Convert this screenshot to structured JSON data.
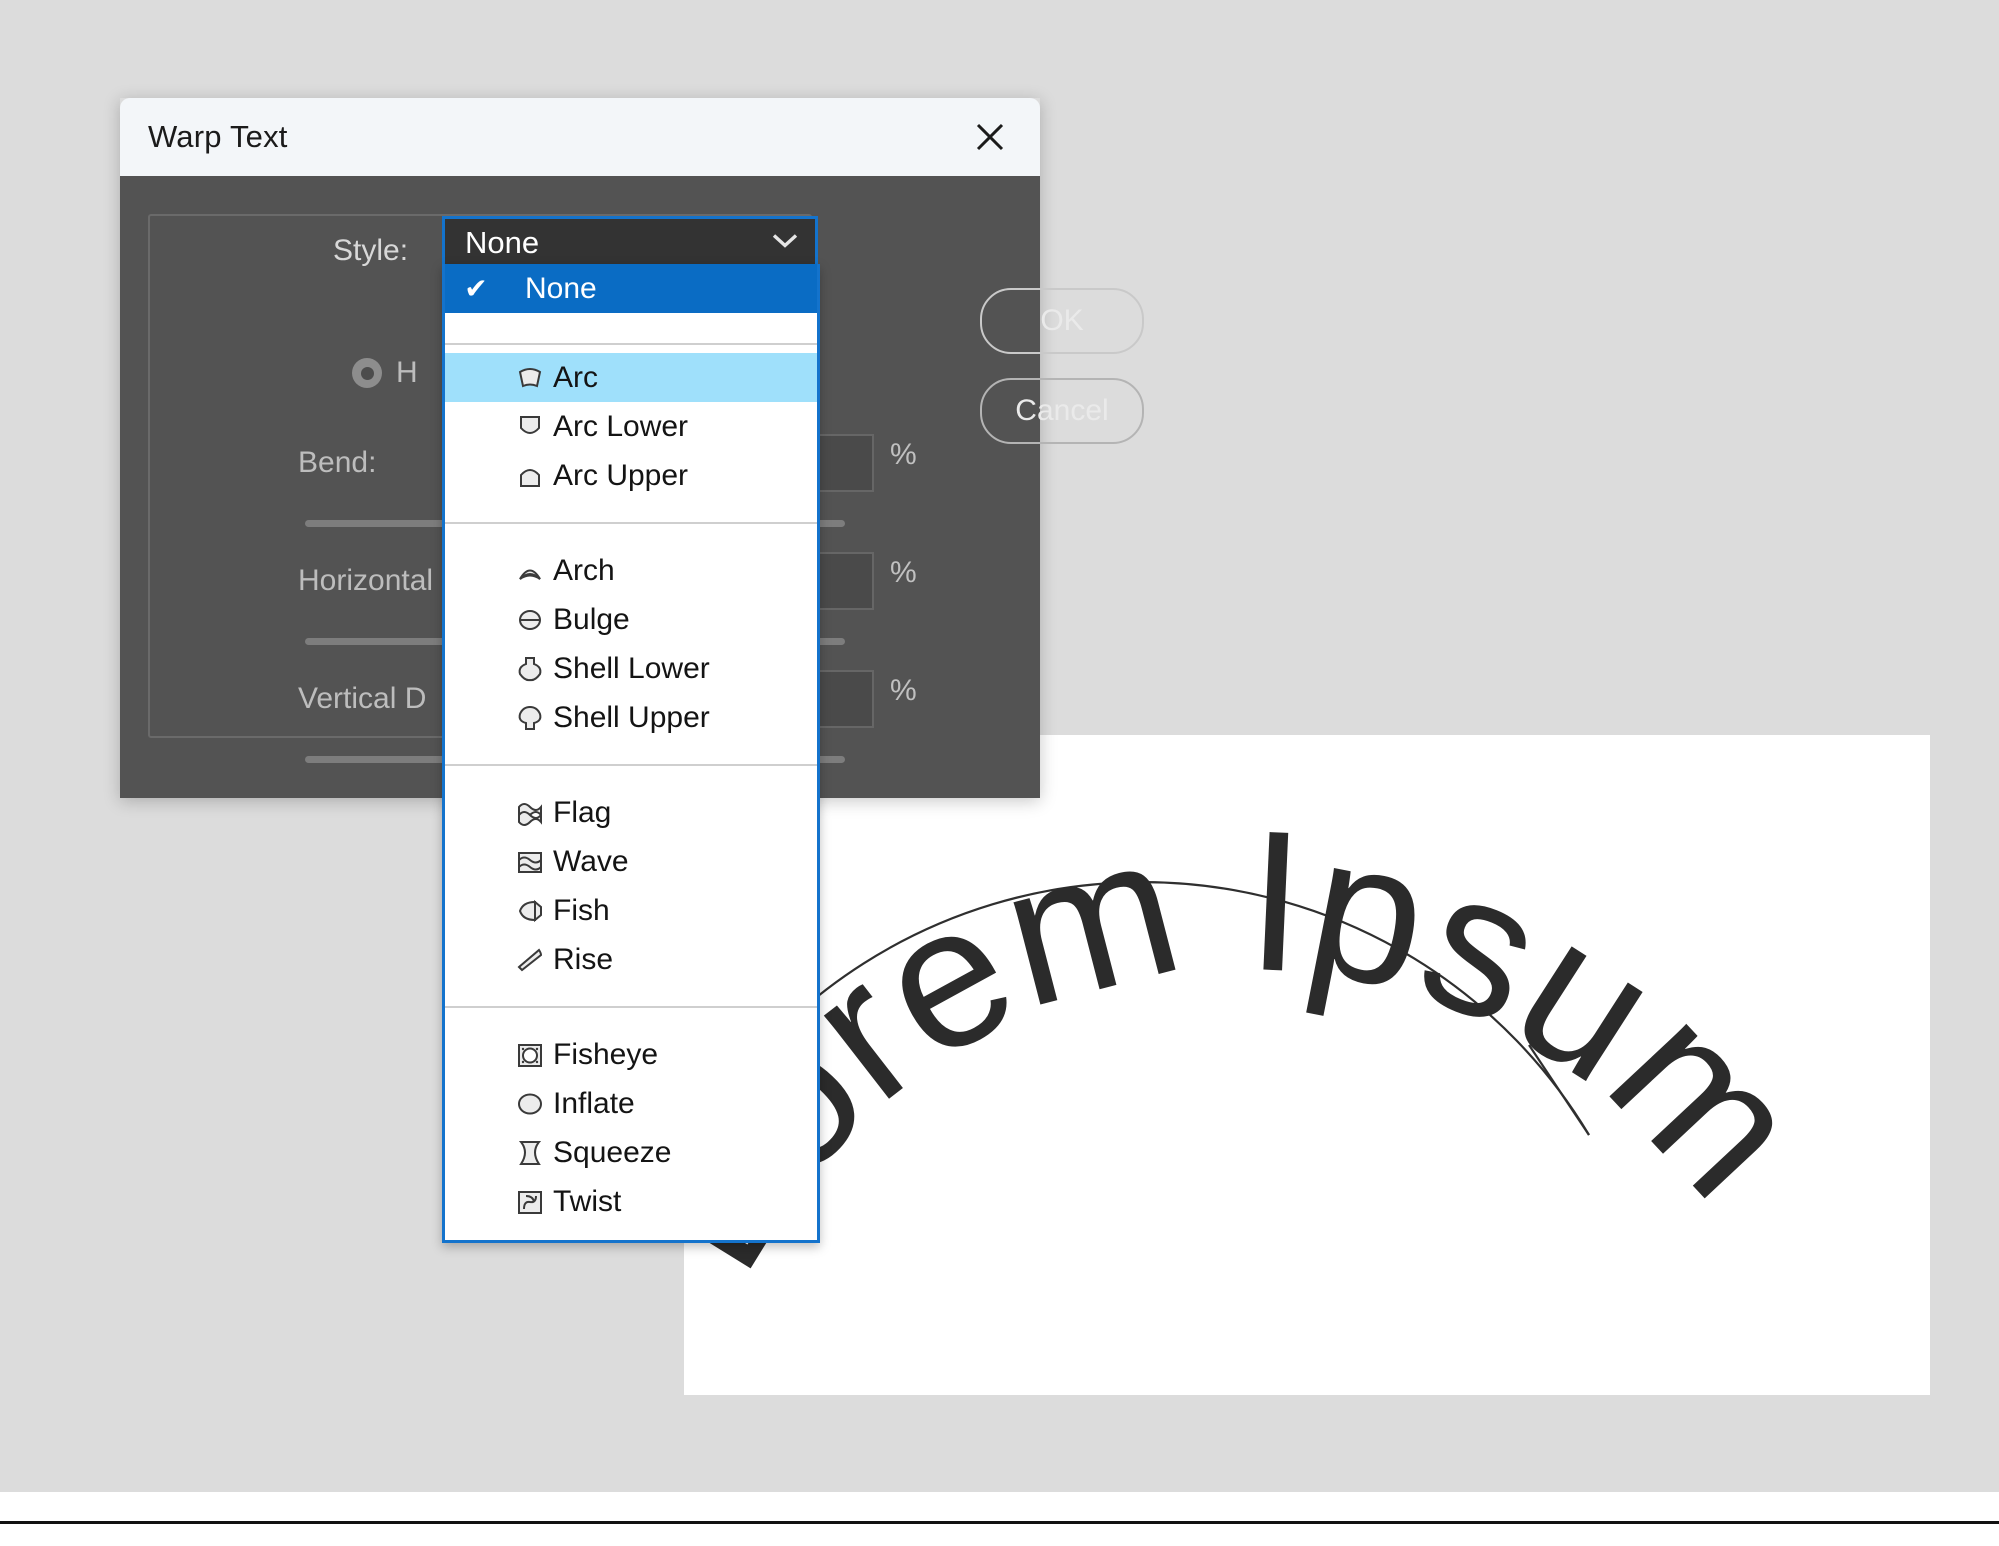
{
  "app": {
    "background_color": "#dcdcdc",
    "canvas_color": "#ffffff"
  },
  "dialog": {
    "title": "Warp Text",
    "close_icon": "close-x-icon",
    "titlebar_color": "#f3f6f9",
    "body_color": "#535353",
    "style_label": "Style:",
    "orientation": {
      "selected": "horizontal",
      "horizontal_label": "H"
    },
    "fields": [
      {
        "label": "Bend:",
        "unit": "%"
      },
      {
        "label": "Horizontal",
        "unit": "%"
      },
      {
        "label": "Vertical D",
        "unit": "%"
      }
    ],
    "buttons": {
      "ok": "OK",
      "cancel": "Cancel"
    }
  },
  "style_select": {
    "value": "None",
    "caret_icon": "chevron-down-icon",
    "accent_color": "#1473cc",
    "selected_color": "#0a6cc4",
    "hover_color": "#9fe0fb",
    "selected_option": "None",
    "hovered_option": "Arc",
    "groups": [
      {
        "items": [
          {
            "label": "None",
            "icon": "none-icon",
            "state": "selected",
            "check": "✔"
          }
        ]
      },
      {
        "items": [
          {
            "label": "Arc",
            "icon": "arc-icon",
            "state": "hovered"
          },
          {
            "label": "Arc Lower",
            "icon": "arc-lower-icon",
            "state": "normal"
          },
          {
            "label": "Arc Upper",
            "icon": "arc-upper-icon",
            "state": "normal"
          }
        ]
      },
      {
        "items": [
          {
            "label": "Arch",
            "icon": "arch-icon",
            "state": "normal"
          },
          {
            "label": "Bulge",
            "icon": "bulge-icon",
            "state": "normal"
          },
          {
            "label": "Shell Lower",
            "icon": "shell-lower-icon",
            "state": "normal"
          },
          {
            "label": "Shell Upper",
            "icon": "shell-upper-icon",
            "state": "normal"
          }
        ]
      },
      {
        "items": [
          {
            "label": "Flag",
            "icon": "flag-icon",
            "state": "normal"
          },
          {
            "label": "Wave",
            "icon": "wave-icon",
            "state": "normal"
          },
          {
            "label": "Fish",
            "icon": "fish-icon",
            "state": "normal"
          },
          {
            "label": "Rise",
            "icon": "rise-icon",
            "state": "normal"
          }
        ]
      },
      {
        "items": [
          {
            "label": "Fisheye",
            "icon": "fisheye-icon",
            "state": "normal"
          },
          {
            "label": "Inflate",
            "icon": "inflate-icon",
            "state": "normal"
          },
          {
            "label": "Squeeze",
            "icon": "squeeze-icon",
            "state": "normal"
          },
          {
            "label": "Twist",
            "icon": "twist-icon",
            "state": "normal"
          }
        ]
      }
    ]
  },
  "document": {
    "warped_text": "Lorem Ipsum",
    "text_color": "#2b2b2b",
    "warp_applied": "Arc"
  }
}
